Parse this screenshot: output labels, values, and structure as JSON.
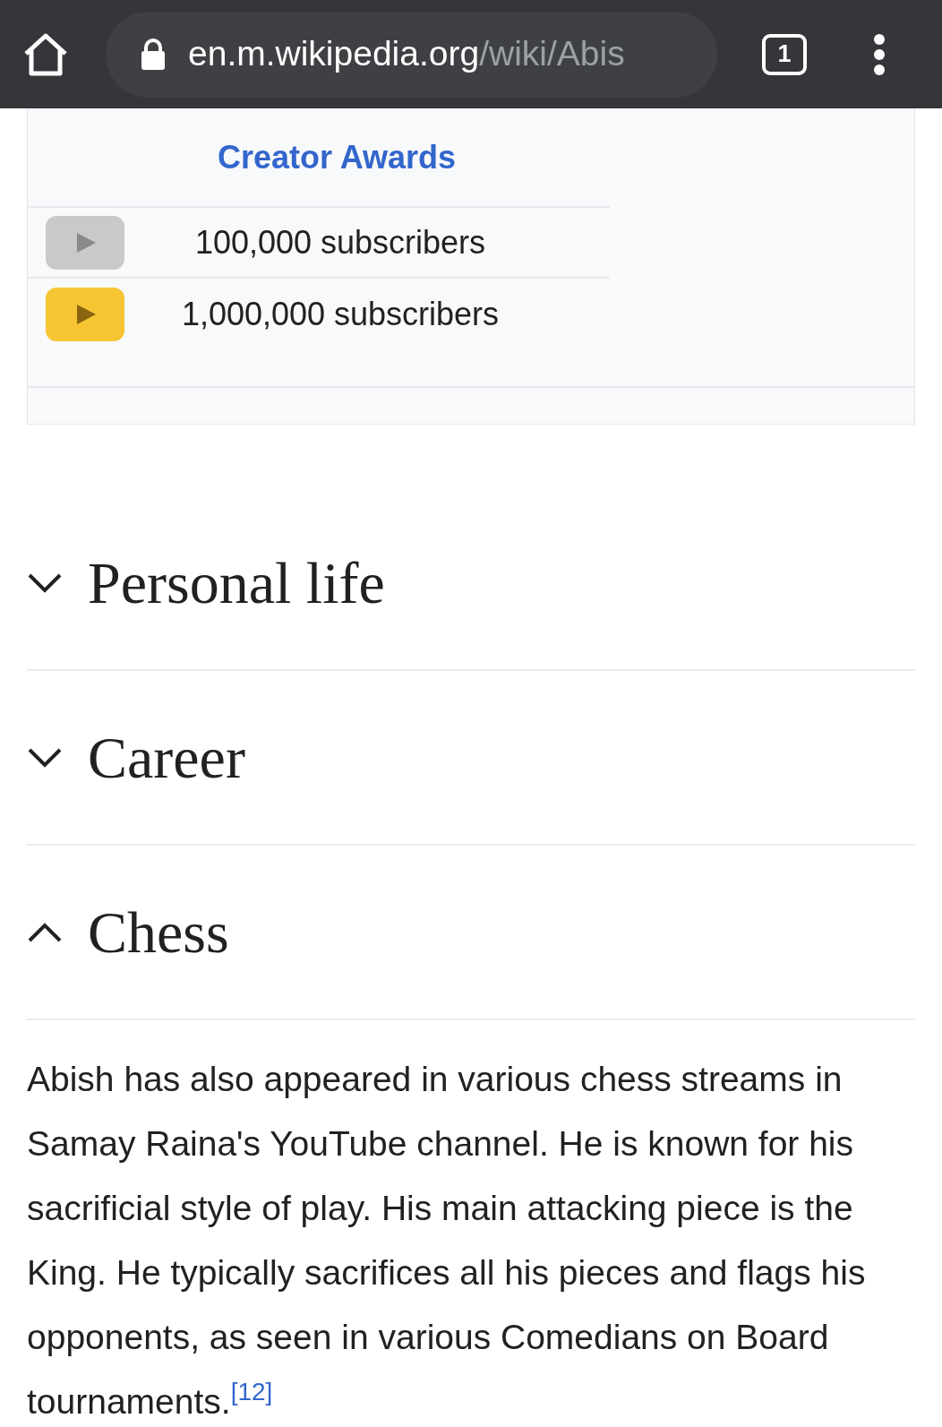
{
  "browser_bar": {
    "url_host": "en.m.wikipedia.org",
    "url_path": "/wiki/Abis",
    "tab_count": "1"
  },
  "infobox": {
    "header": "Creator Awards",
    "awards": [
      {
        "kind": "silver",
        "label": "100,000 subscribers"
      },
      {
        "kind": "gold",
        "label": "1,000,000 subscribers"
      }
    ]
  },
  "sections": [
    {
      "title": "Personal life",
      "expanded": false
    },
    {
      "title": "Career",
      "expanded": false
    },
    {
      "title": "Chess",
      "expanded": true
    }
  ],
  "chess_paragraph": {
    "text": "Abish has also appeared in various chess streams in Samay Raina's YouTube channel. He is known for his sacrificial style of play. His main attacking piece is the King. He typically sacrifices all his pieces and flags his opponents, as seen in various Comedians on Board tournaments.",
    "citation": "[12]"
  }
}
